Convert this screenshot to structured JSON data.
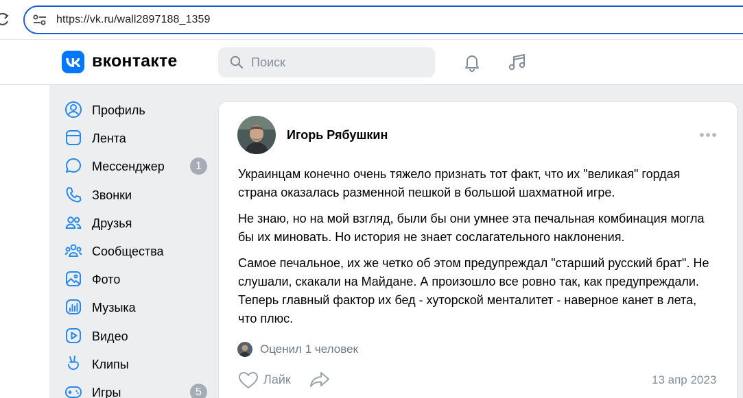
{
  "browser": {
    "url": "https://vk.ru/wall2897188_1359"
  },
  "header": {
    "brand": "вконтакте",
    "search_placeholder": "Поиск"
  },
  "sidebar": {
    "items": [
      {
        "label": "Профиль",
        "icon": "profile-icon"
      },
      {
        "label": "Лента",
        "icon": "feed-icon"
      },
      {
        "label": "Мессенджер",
        "icon": "messenger-icon",
        "badge": "1"
      },
      {
        "label": "Звонки",
        "icon": "phone-icon"
      },
      {
        "label": "Друзья",
        "icon": "friends-icon"
      },
      {
        "label": "Сообщества",
        "icon": "communities-icon"
      },
      {
        "label": "Фото",
        "icon": "photo-icon"
      },
      {
        "label": "Музыка",
        "icon": "music-icon"
      },
      {
        "label": "Видео",
        "icon": "video-icon"
      },
      {
        "label": "Клипы",
        "icon": "clips-icon"
      },
      {
        "label": "Игры",
        "icon": "games-icon",
        "badge": "5"
      }
    ]
  },
  "post": {
    "author": "Игорь Рябушкин",
    "paragraphs": [
      "Украинцам конечно очень тяжело признать тот факт, что их \"великая\" гордая страна оказалась разменной пешкой в большой шахматной игре.",
      "Не знаю, но на мой взгляд, были бы они умнее эта печальная комбинация могла бы их миновать. Но история не знает сослагательного наклонения.",
      "Самое печальное, их же четко об этом предупреждал \"старший русский брат\". Не слушали, скакали на Майдане. А произошло все ровно так, как предупреждали. Теперь главный фактор их бед - хуторской менталитет - наверное канет в лета, что плюс."
    ],
    "liked_by": "Оценил 1 человек",
    "like_label": "Лайк",
    "date": "13 апр 2023"
  },
  "colors": {
    "accent": "#0077ff",
    "background": "#edeef0",
    "secondary_text": "#818c99",
    "badge": "#a5acb6"
  }
}
